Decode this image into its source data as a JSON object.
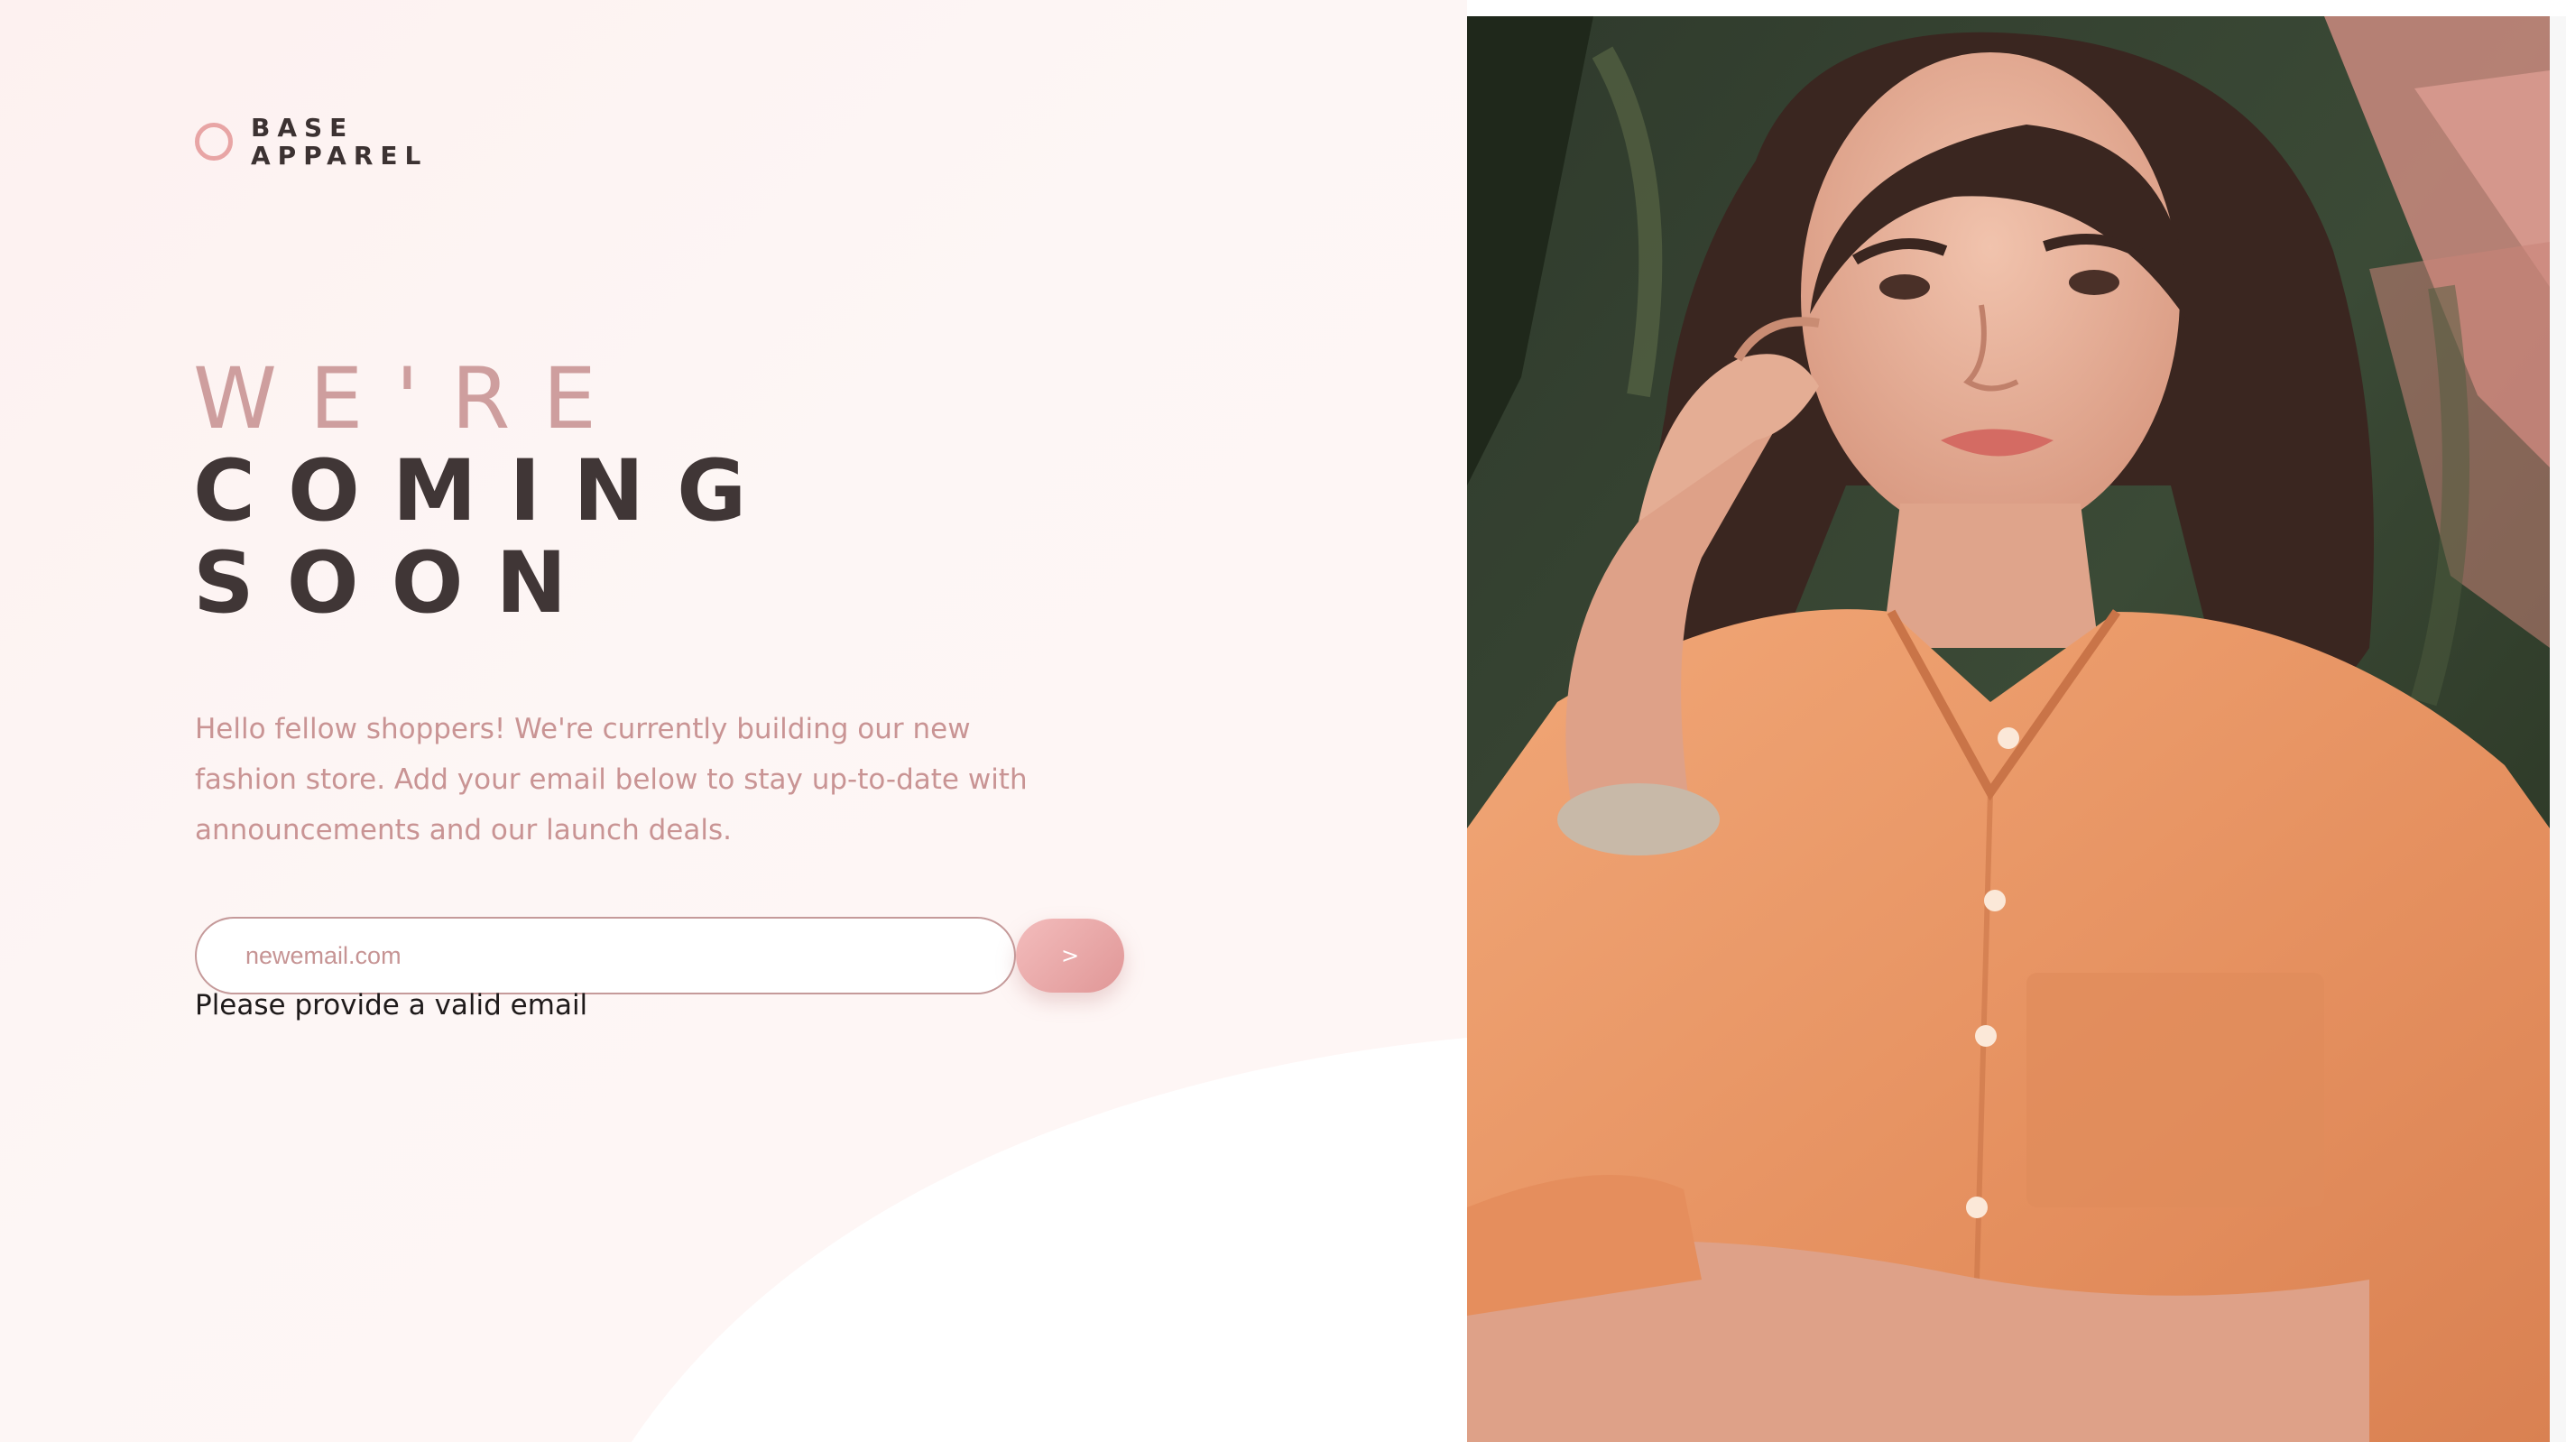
{
  "brand": {
    "line1": "BASE",
    "line2": "APPAREL",
    "accent_color": "#e8a5a5",
    "icon": "circle-logo-icon"
  },
  "headline": {
    "line1": "WE'RE",
    "line2": "COMING",
    "line3": "SOON"
  },
  "intro": "Hello fellow shoppers! We're currently building our new fashion store. Add your email below to stay up-to-date with announcements and our launch deals.",
  "form": {
    "email_value": "newemail.com",
    "submit_label": ">",
    "error_message": "Please provide a valid email"
  },
  "colors": {
    "primary_text": "#403636",
    "desaturated_red": "#ce9797",
    "error": "#1e1a1a"
  },
  "hero": {
    "image": "woman-in-orange-shirt-photo"
  }
}
